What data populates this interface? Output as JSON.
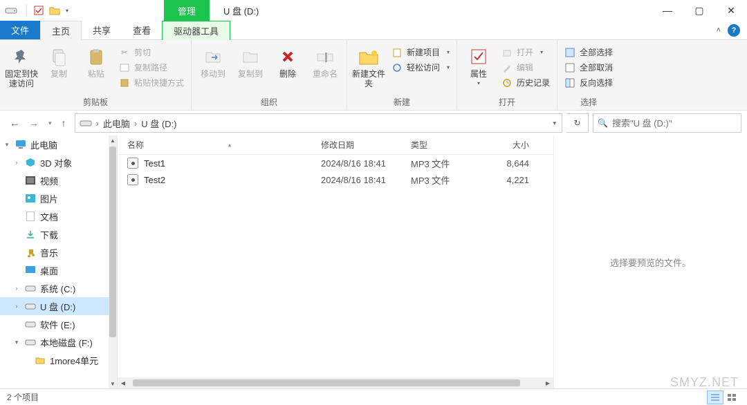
{
  "window": {
    "context_tab": "管理",
    "title": "U 盘 (D:)",
    "min": "—",
    "max": "▢",
    "close": "✕"
  },
  "tabs": {
    "file": "文件",
    "home": "主页",
    "share": "共享",
    "view": "查看",
    "drive_tools": "驱动器工具",
    "expand": "˄",
    "help": "?"
  },
  "ribbon": {
    "clipboard": {
      "label": "剪贴板",
      "pin": "固定到快速访问",
      "copy": "复制",
      "paste": "粘贴",
      "cut": "剪切",
      "copy_path": "复制路径",
      "paste_shortcut": "粘贴快捷方式"
    },
    "organize": {
      "label": "组织",
      "move_to": "移动到",
      "copy_to": "复制到",
      "delete": "删除",
      "rename": "重命名"
    },
    "new": {
      "label": "新建",
      "new_folder": "新建文件夹",
      "new_item": "新建项目",
      "easy_access": "轻松访问"
    },
    "open": {
      "label": "打开",
      "properties": "属性",
      "open": "打开",
      "edit": "编辑",
      "history": "历史记录"
    },
    "select": {
      "label": "选择",
      "select_all": "全部选择",
      "select_none": "全部取消",
      "invert": "反向选择"
    }
  },
  "nav": {
    "this_pc": "此电脑",
    "location": "U 盘 (D:)",
    "search_placeholder": "搜索\"U 盘 (D:)\""
  },
  "tree": {
    "root": "此电脑",
    "items": [
      "3D 对象",
      "视频",
      "图片",
      "文档",
      "下载",
      "音乐",
      "桌面",
      "系统 (C:)",
      "U 盘 (D:)",
      "软件 (E:)",
      "本地磁盘 (F:)"
    ],
    "subitem": "1more4单元"
  },
  "columns": {
    "name": "名称",
    "date": "修改日期",
    "type": "类型",
    "size": "大小"
  },
  "files": [
    {
      "name": "Test1",
      "date": "2024/8/16 18:41",
      "type": "MP3 文件",
      "size": "8,644"
    },
    {
      "name": "Test2",
      "date": "2024/8/16 18:41",
      "type": "MP3 文件",
      "size": "4,221"
    }
  ],
  "preview": {
    "message": "选择要预览的文件。"
  },
  "status": {
    "count": "2 个项目"
  },
  "watermark": "SMYZ.NET"
}
